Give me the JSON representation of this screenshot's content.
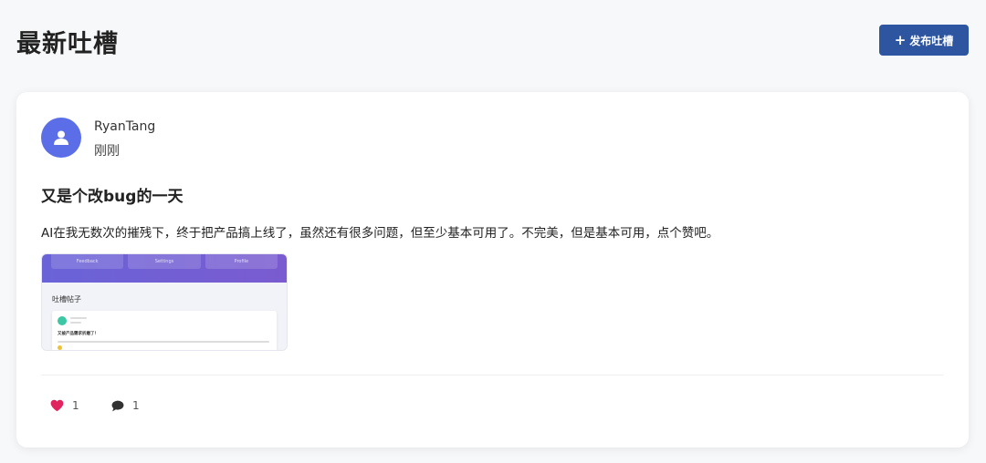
{
  "header": {
    "title": "最新吐槽",
    "post_button_icon": "plus-icon",
    "post_button_label": "发布吐槽",
    "accent_color": "#2d55a0"
  },
  "post": {
    "author": "RyanTang",
    "time": "刚刚",
    "avatar_icon": "user-icon",
    "avatar_color": "#5b6ee8",
    "title": "又是个改bug的一天",
    "body": "AI在我无数次的摧残下，终于把产品搞上线了，虽然还有很多问题，但至少基本可用了。不完美，但是基本可用，点个赞吧。",
    "image": {
      "nav_tabs": [
        "Feedback",
        "Settings",
        "Profile"
      ],
      "heading": "吐槽帖子",
      "subtitle": "又被产品需求折磨了！"
    },
    "likes": {
      "icon": "heart-icon",
      "count": "1",
      "color": "#e0245e"
    },
    "comments": {
      "icon": "comment-icon",
      "count": "1"
    }
  }
}
